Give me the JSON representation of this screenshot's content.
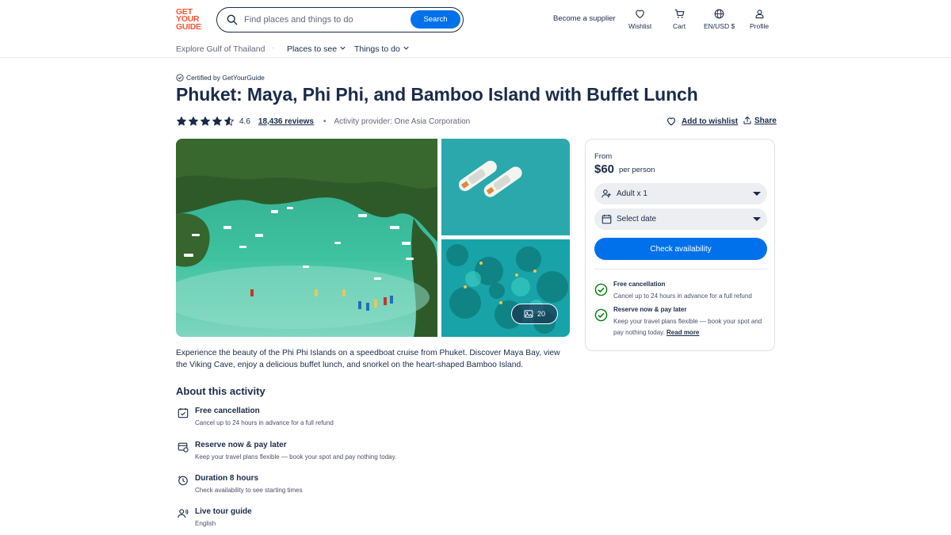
{
  "brand": {
    "logo_lines": [
      "GET",
      "YOUR",
      "GUIDE"
    ],
    "color": "#ff5533"
  },
  "header": {
    "search_placeholder": "Find places and things to do",
    "search_button": "Search",
    "supplier_link": "Become a supplier",
    "nav": [
      {
        "label": "Wishlist",
        "icon": "heart-icon"
      },
      {
        "label": "Cart",
        "icon": "cart-icon"
      },
      {
        "label": "EN/USD $",
        "icon": "globe-icon"
      },
      {
        "label": "Profile",
        "icon": "profile-icon"
      }
    ]
  },
  "subnav": {
    "explore": "Explore Gulf of Thailand",
    "places": "Places to see",
    "things": "Things to do"
  },
  "activity": {
    "certified": "Certified by GetYourGuide",
    "title": "Phuket: Maya, Phi Phi, and Bamboo Island with Buffet Lunch",
    "rating": "4.6",
    "rating_stars": 4.6,
    "reviews": "18,436 reviews",
    "provider": "Activity provider: One Asia Corporation",
    "wishlist": "Add to wishlist",
    "share": "Share",
    "photo_count": "20",
    "description": "Experience the beauty of the Phi Phi Islands on a speedboat cruise from Phuket. Discover Maya Bay, view the Viking Cave, enjoy a delicious buffet lunch, and snorkel on the heart-shaped Bamboo Island."
  },
  "about": {
    "title": "About this activity",
    "items": [
      {
        "title": "Free cancellation",
        "sub": "Cancel up to 24 hours in advance for a full refund",
        "icon": "calendar-check-icon"
      },
      {
        "title": "Reserve now & pay later",
        "sub": "Keep your travel plans flexible — book your spot and pay nothing today.",
        "icon": "wallet-calendar-icon"
      },
      {
        "title": "Duration 8 hours",
        "sub": "Check availability to see starting times",
        "icon": "clock-icon"
      },
      {
        "title": "Live tour guide",
        "sub": "English",
        "icon": "guide-icon"
      }
    ]
  },
  "booking": {
    "from": "From",
    "price": "$60",
    "per": "per person",
    "participants": "Adult x 1",
    "date": "Select date",
    "check": "Check availability",
    "perks": [
      {
        "title": "Free cancellation",
        "sub": "Cancel up to 24 hours in advance for a full refund"
      },
      {
        "title": "Reserve now & pay later",
        "sub": "Keep your travel plans flexible — book your spot and pay nothing today.",
        "link": "Read more"
      }
    ],
    "accent_color": "#0071eb",
    "check_color": "#008009"
  }
}
